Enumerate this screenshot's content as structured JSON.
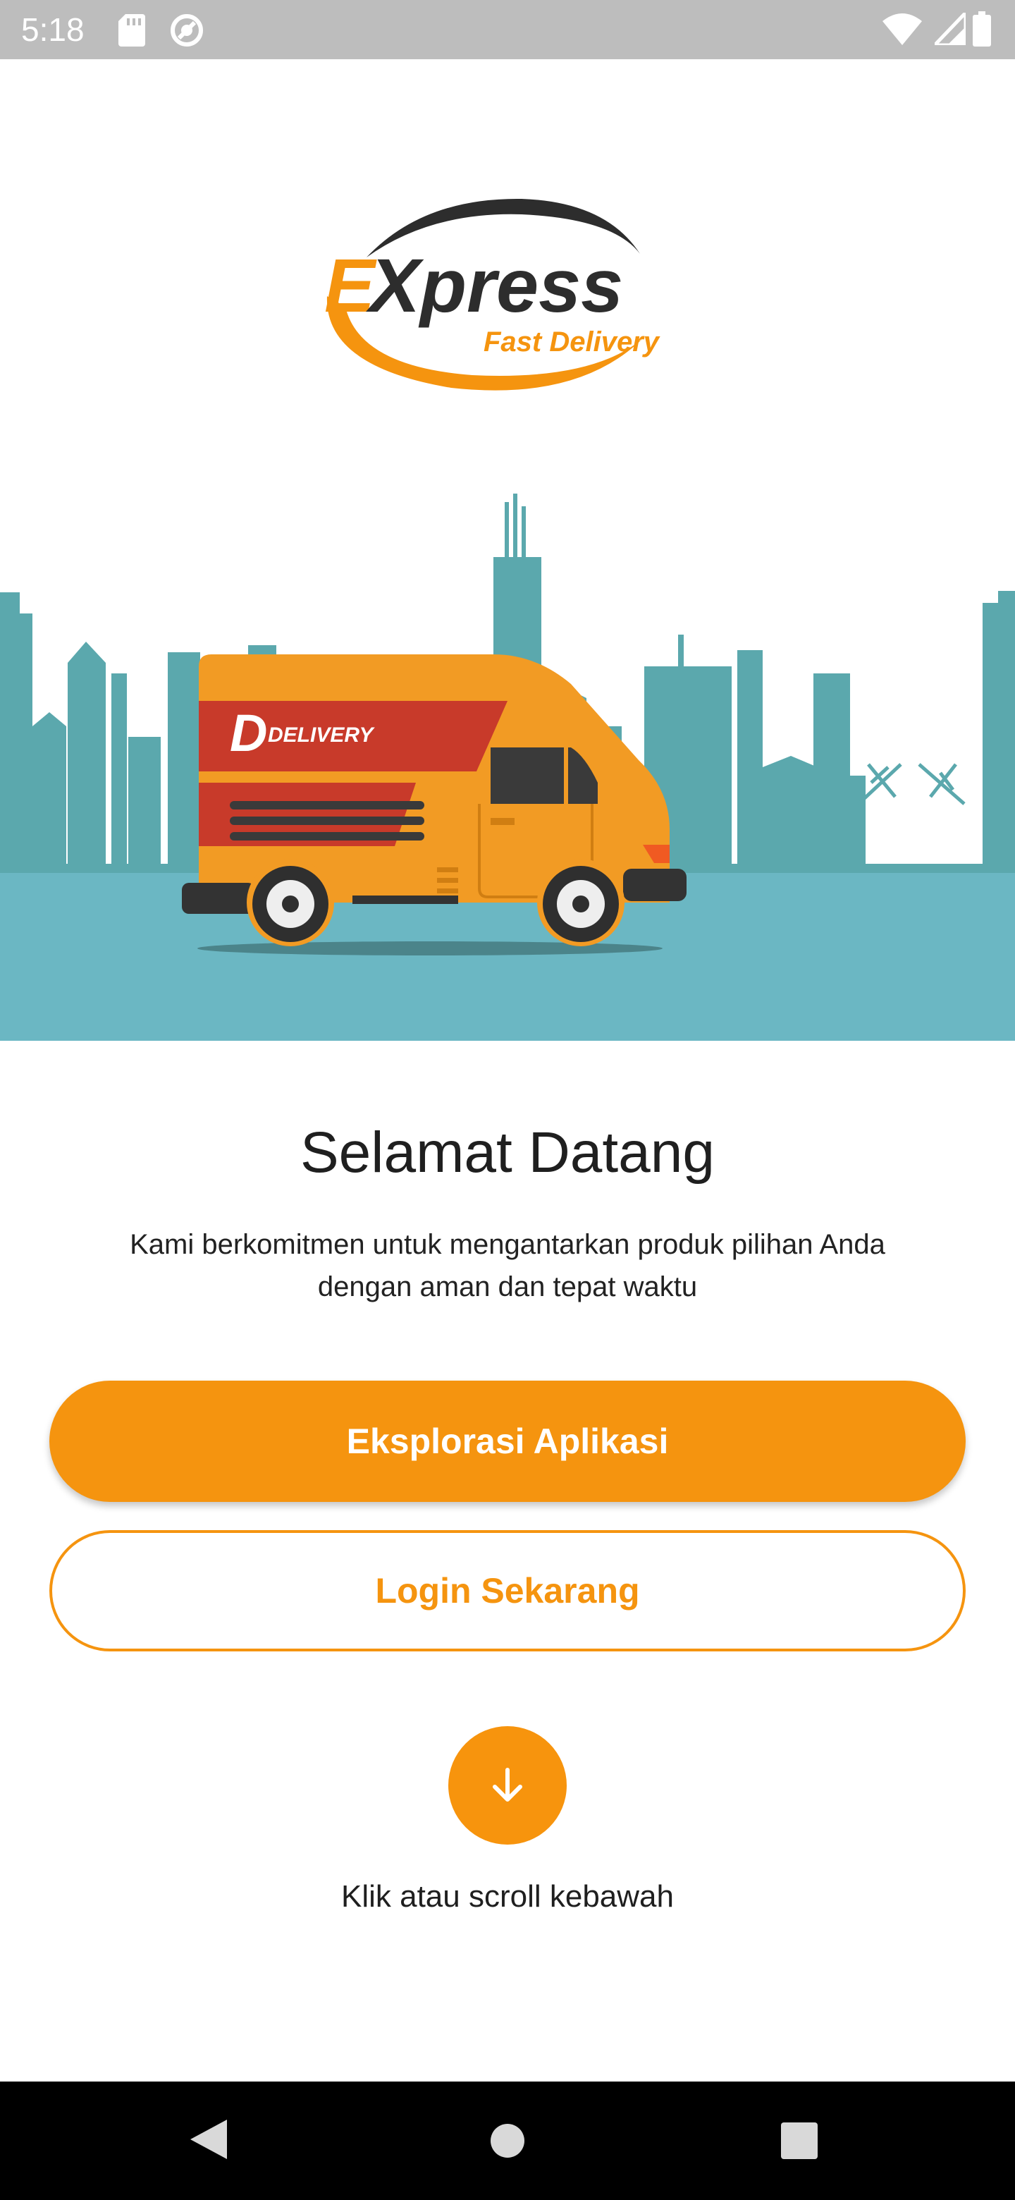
{
  "status_bar": {
    "time": "5:18",
    "icons": [
      "sd-card-icon",
      "sync-icon",
      "wifi-icon",
      "signal-icon",
      "battery-icon"
    ],
    "background": "#bdbdbd"
  },
  "logo": {
    "brand": "EXpress",
    "tagline": "Fast Delivery"
  },
  "hero": {
    "van_label": "DELIVERY",
    "colors": {
      "skyline": "#5ba8ad",
      "ground": "#6bb7c3",
      "van_body": "#f29b24",
      "van_stripe": "#c83a2a"
    }
  },
  "welcome": {
    "title": "Selamat Datang",
    "subtitle_line1": "Kami berkomitmen untuk mengantarkan produk pilihan Anda",
    "subtitle_line2": "dengan aman dan tepat waktu"
  },
  "actions": {
    "explore_label": "Eksplorasi Aplikasi",
    "login_label": "Login Sekarang",
    "scroll_icon": "arrow-down-icon",
    "scroll_hint": "Klik atau scroll kebawah"
  },
  "accent_color": "#f5940f",
  "nav_bar": {
    "icons": [
      "back-icon",
      "home-icon",
      "recent-apps-icon"
    ]
  }
}
